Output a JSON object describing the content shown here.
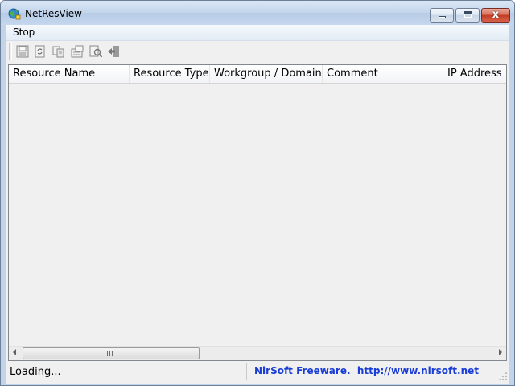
{
  "window": {
    "title": "NetResView",
    "close_glyph": "x"
  },
  "menu": {
    "items": [
      "Stop"
    ]
  },
  "toolbar": {
    "buttons": [
      "save-icon",
      "refresh-icon",
      "copy-icon",
      "properties-icon",
      "find-icon",
      "exit-icon"
    ]
  },
  "list": {
    "columns": [
      "Resource Name",
      "Resource Type",
      "Workgroup / Domain",
      "Comment",
      "IP Address"
    ],
    "rows": []
  },
  "status": {
    "text": "Loading...",
    "link": "NirSoft Freeware.  http://www.nirsoft.net"
  },
  "colors": {
    "link": "#1a3dd6",
    "close_button": "#c33c23"
  }
}
